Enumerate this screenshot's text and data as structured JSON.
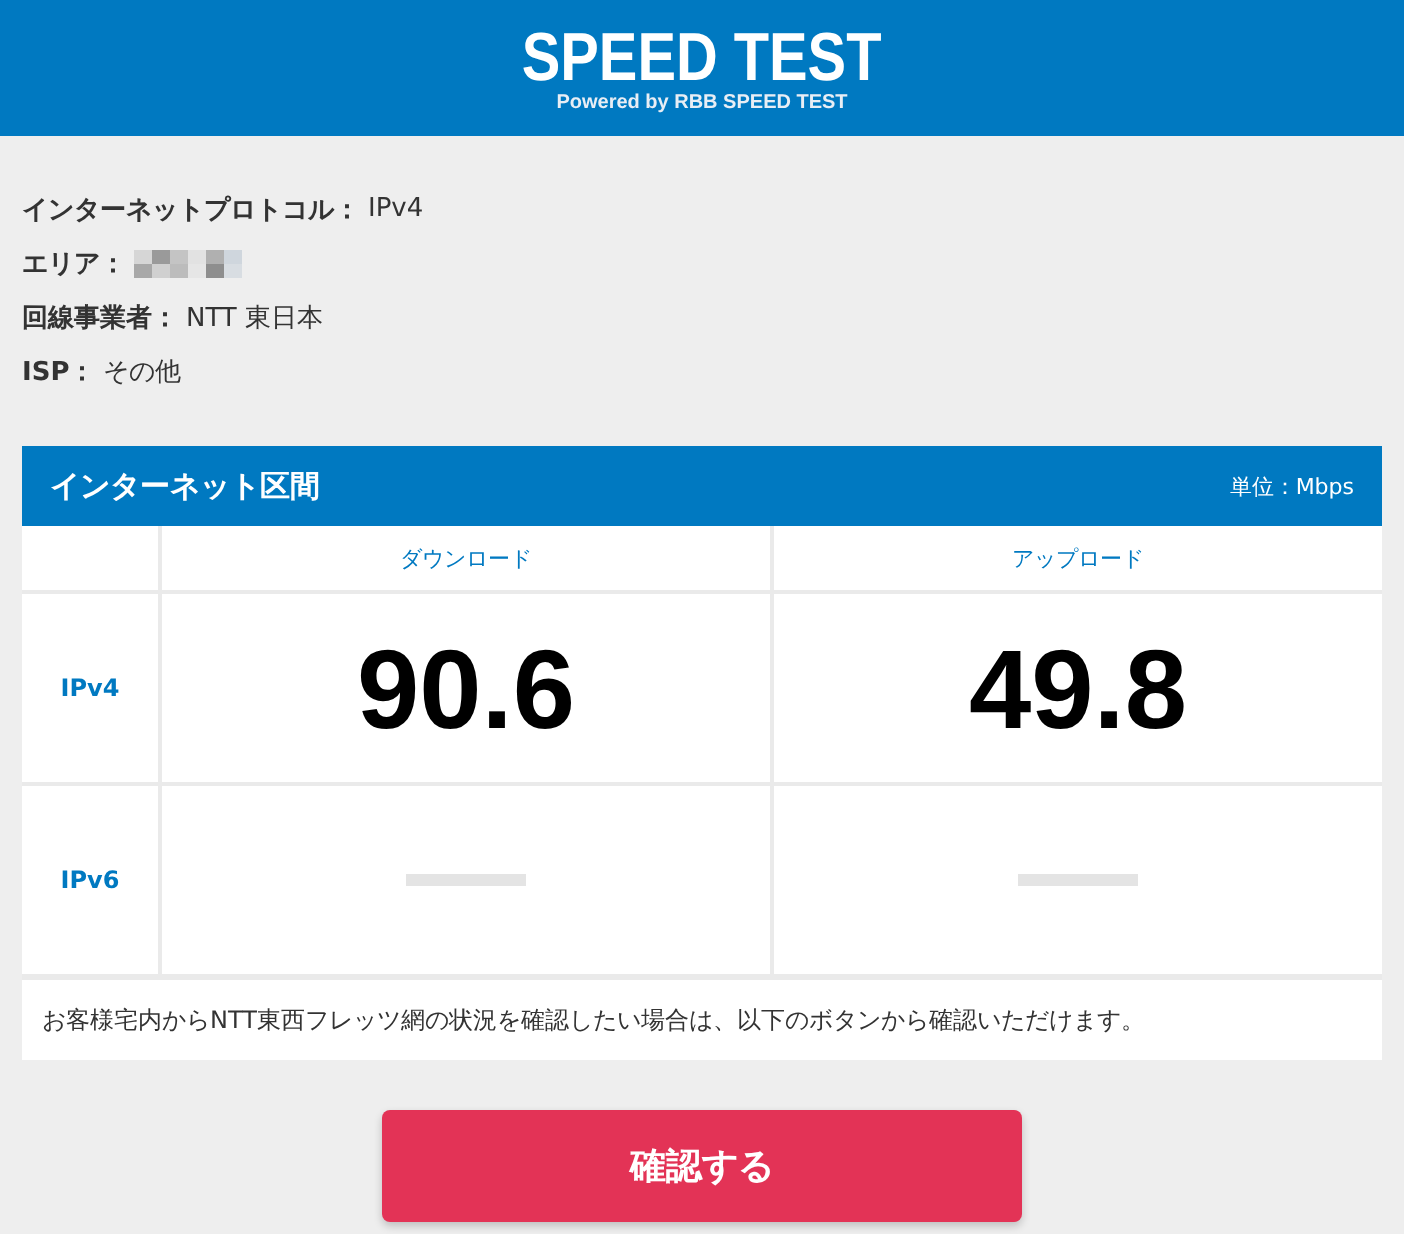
{
  "header": {
    "title": "SPEED TEST",
    "subtitle": "Powered by RBB SPEED TEST"
  },
  "info": [
    {
      "kind": "text",
      "label": "インターネットプロトコル：",
      "value": "IPv4"
    },
    {
      "kind": "redacted",
      "label": "エリア："
    },
    {
      "kind": "text",
      "label": "回線事業者：",
      "value": "NTT 東日本"
    },
    {
      "kind": "text",
      "label": "ISP：",
      "value": "その他"
    }
  ],
  "results": {
    "title": "インターネット区間",
    "unit": "単位：Mbps",
    "columns": [
      "ダウンロード",
      "アップロード"
    ],
    "rows": [
      {
        "label": "IPv4",
        "cells": [
          {
            "kind": "value",
            "text": "90.6"
          },
          {
            "kind": "value",
            "text": "49.8"
          }
        ]
      },
      {
        "label": "IPv6",
        "cells": [
          {
            "kind": "empty"
          },
          {
            "kind": "empty"
          }
        ]
      }
    ],
    "note": "お客様宅内からNTT東西フレッツ網の状況を確認したい場合は、以下のボタンから確認いただけます。"
  },
  "button": "確認する"
}
